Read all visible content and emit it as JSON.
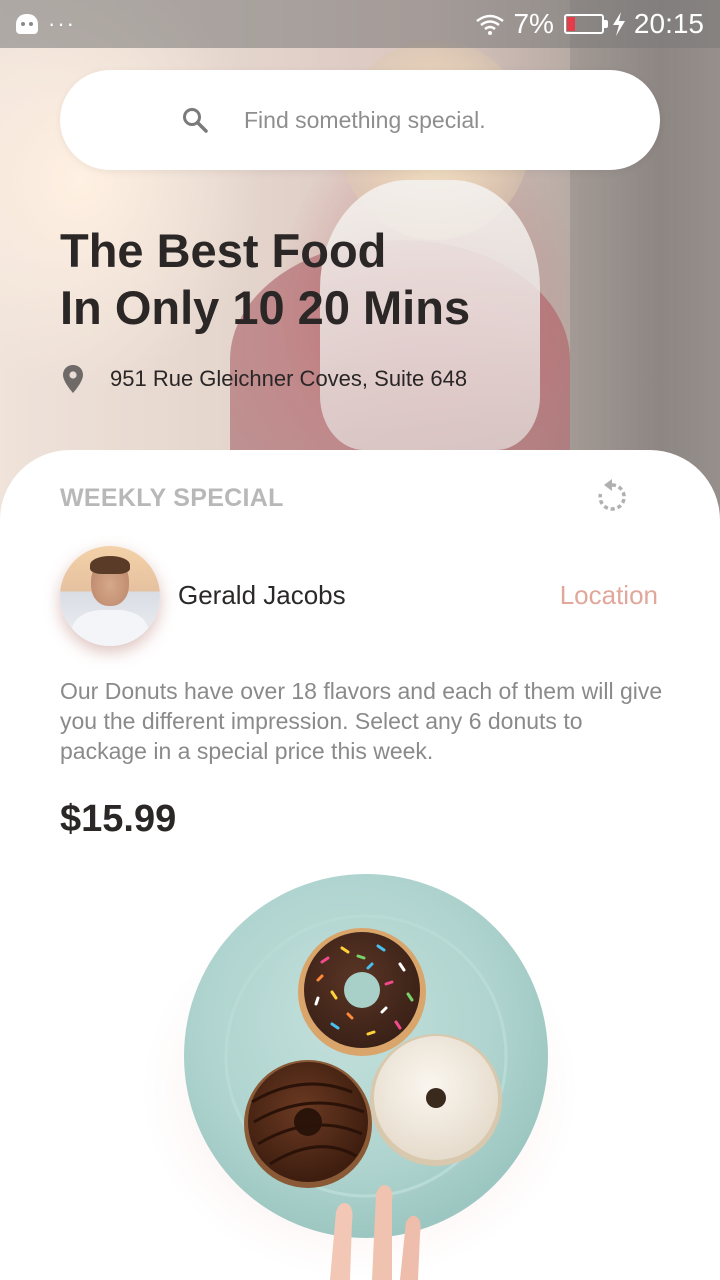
{
  "status_bar": {
    "battery": "7%",
    "time": "20:15",
    "battery_color": "#e53c4a"
  },
  "search": {
    "placeholder": "Find something special."
  },
  "hero": {
    "headline_line1": "The Best Food",
    "headline_line2": "In Only 10 20 Mins",
    "address": "951 Rue Gleichner Coves, Suite 648"
  },
  "special": {
    "section_label": "WEEKLY SPECIAL",
    "author": "Gerald Jacobs",
    "location_link": "Location",
    "description": "Our Donuts have over 18 flavors and each of them will give you the different impression. Select any 6 donuts to package in a special price this week.",
    "price": "$15.99"
  },
  "colors": {
    "accent": "#e0a79a",
    "muted": "#8a8a8a",
    "label": "#b8b8b8",
    "plate": "#a9cfc9"
  }
}
